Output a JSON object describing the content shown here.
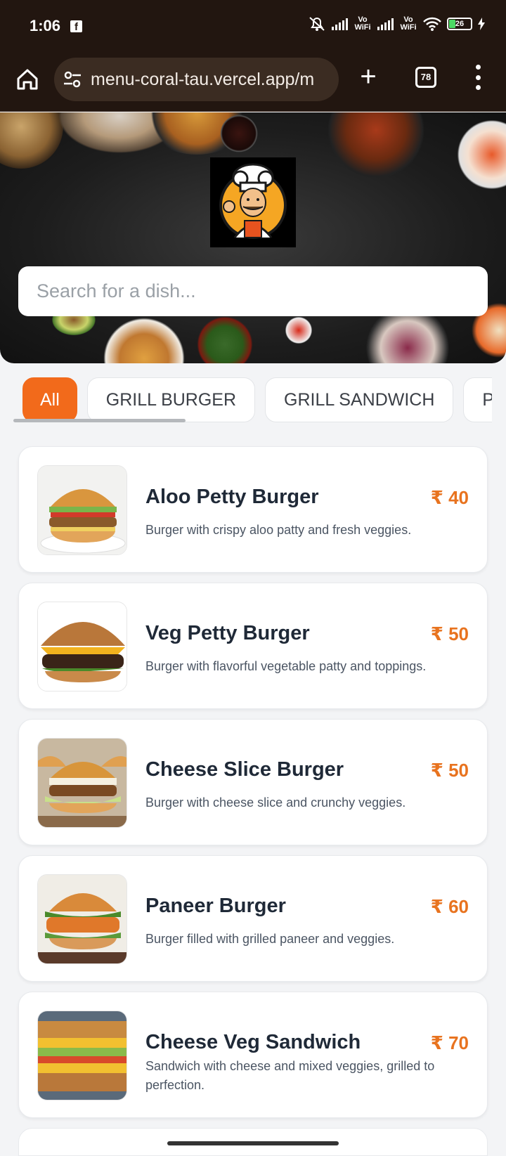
{
  "status_bar": {
    "time": "1:06",
    "vowifi_1": "Vo WiFi",
    "vowifi_2": "Vo WiFi",
    "battery": "26"
  },
  "browser": {
    "url": "menu-coral-tau.vercel.app/m",
    "tab_count": "78"
  },
  "search": {
    "placeholder": "Search for a dish..."
  },
  "categories": [
    {
      "label": "All",
      "active": true
    },
    {
      "label": "GRILL BURGER",
      "active": false
    },
    {
      "label": "GRILL SANDWICH",
      "active": false
    },
    {
      "label": "PIZZ",
      "active": false
    }
  ],
  "menu_items": [
    {
      "name": "Aloo Petty Burger",
      "price": "₹ 40",
      "description": "Burger with crispy aloo patty and fresh veggies.",
      "image": "burger-photo"
    },
    {
      "name": "Veg Petty Burger",
      "price": "₹ 50",
      "description": "Burger with flavorful vegetable patty and toppings.",
      "image": "cheese-burger-photo"
    },
    {
      "name": "Cheese Slice Burger",
      "price": "₹ 50",
      "description": "Burger with cheese slice and crunchy veggies.",
      "image": "burger-photo"
    },
    {
      "name": "Paneer Burger",
      "price": "₹ 60",
      "description": "Burger filled with grilled paneer and veggies.",
      "image": "paneer-burger-photo"
    },
    {
      "name": "Cheese Veg Sandwich",
      "price": "₹ 70",
      "description": "Sandwich with cheese and mixed veggies, grilled to perfection.",
      "image": "sandwich-photo"
    }
  ],
  "colors": {
    "accent": "#f26a1b",
    "price": "#e8731f",
    "browser_chrome": "#221610"
  }
}
